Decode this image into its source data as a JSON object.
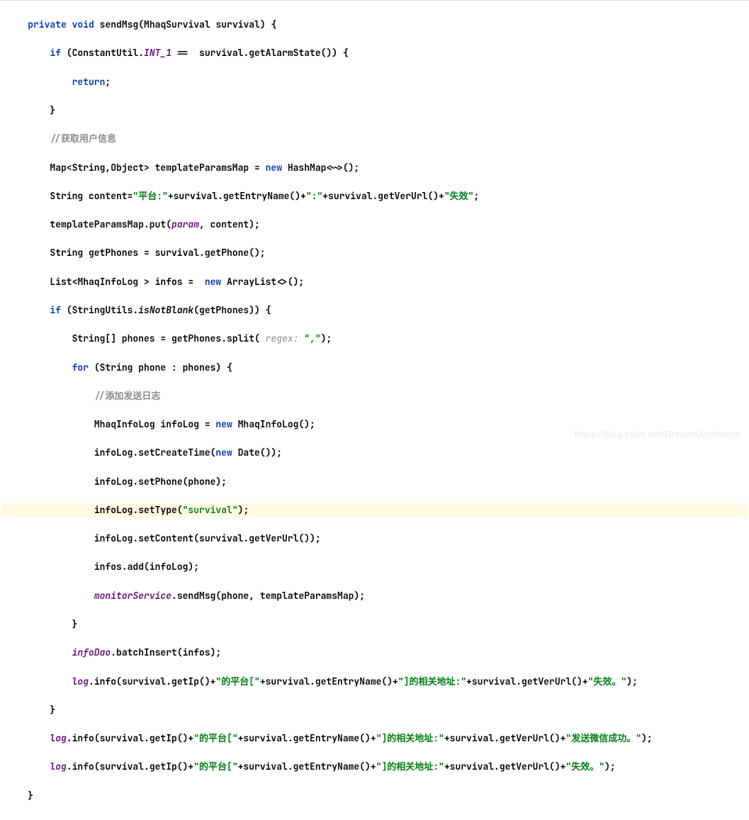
{
  "code": {
    "l1_kw1": "private",
    "l1_kw2": "void",
    "l1_method": "sendMsg",
    "l1_param": "(MhaqSurvival survival) {",
    "l2_kw": "if",
    "l2_open": " (ConstantUtil.",
    "l2_field": "INT_1",
    "l2_rest": " ==  survival.getAlarmState()) {",
    "l3_kw": "return",
    "l3_semi": ";",
    "l4": "}",
    "l5": "//获取用户信息",
    "l6_a": "Map<String,Object> templateParamsMap = ",
    "l6_kw": "new",
    "l6_b": " HashMap<~>();",
    "l7_a": "String content=",
    "l7_s1": "\"平台:\"",
    "l7_b": "+survival.getEntryName()+",
    "l7_s2": "\":\"",
    "l7_c": "+survival.getVerUrl()+",
    "l7_s3": "\"失效\"",
    "l7_d": ";",
    "l8_a": "templateParamsMap.put(",
    "l8_field": "param",
    "l8_b": ", content);",
    "l9": "String getPhones = survival.getPhone();",
    "l10_a": "List<MhaqInfoLog > infos =  ",
    "l10_kw": "new",
    "l10_b": " ArrayList<>();",
    "l11_kw": "if",
    "l11_a": " (StringUtils.",
    "l11_m": "isNotBlank",
    "l11_b": "(getPhones)) {",
    "l12_a": "String[] phones = getPhones.split( ",
    "l12_hint": "regex: ",
    "l12_s": "\",\"",
    "l12_b": ");",
    "l13_kw": "for",
    "l13_a": " (String phone : phones) {",
    "l14": "//添加发送日志",
    "l15_a": "MhaqInfoLog infoLog = ",
    "l15_kw": "new",
    "l15_b": " MhaqInfoLog();",
    "l16_a": "infoLog.setCreateTime(",
    "l16_kw": "new",
    "l16_b": " Date());",
    "l17": "infoLog.setPhone(phone);",
    "l18_a": "infoLog.setType(",
    "l18_s": "\"survival\"",
    "l18_b": ");",
    "l19": "infoLog.setContent(survival.getVerUrl());",
    "l20": "infos.add(infoLog);",
    "l21_f": "monitorService",
    "l21_b": ".sendMsg(phone, templateParamsMap);",
    "l22": "}",
    "l23_f": "infoDao",
    "l23_b": ".batchInsert(infos);",
    "l24_f": "log",
    "l24_a": ".info(survival.getIp()+",
    "l24_s1": "\"的平台[\"",
    "l24_b": "+survival.getEntryName()+",
    "l24_s2": "\"]的相关地址:\"",
    "l24_c": "+survival.getVerUrl()+",
    "l24_s3": "\"失效。\"",
    "l24_d": ");",
    "l25": "}",
    "l26_f": "log",
    "l26_a": ".info(survival.getIp()+",
    "l26_s1": "\"的平台[\"",
    "l26_b": "+survival.getEntryName()+",
    "l26_s2": "\"]的相关地址:\"",
    "l26_c": "+survival.getVerUrl()+",
    "l26_s3": "\"发送微信成功。\"",
    "l26_d": ");",
    "l27_f": "log",
    "l27_a": ".info(survival.getIp()+",
    "l27_s1": "\"的平台[\"",
    "l27_b": "+survival.getEntryName()+",
    "l27_s2": "\"]的相关地址:\"",
    "l27_c": "+survival.getVerUrl()+",
    "l27_s3": "\"失效。\"",
    "l27_d": ");",
    "l28": "}"
  },
  "indent": {
    "i1": "    ",
    "i2": "        ",
    "i3": "            ",
    "i4": "                "
  },
  "watermark": "https://blog.csdn.net/DreamsArchitects"
}
